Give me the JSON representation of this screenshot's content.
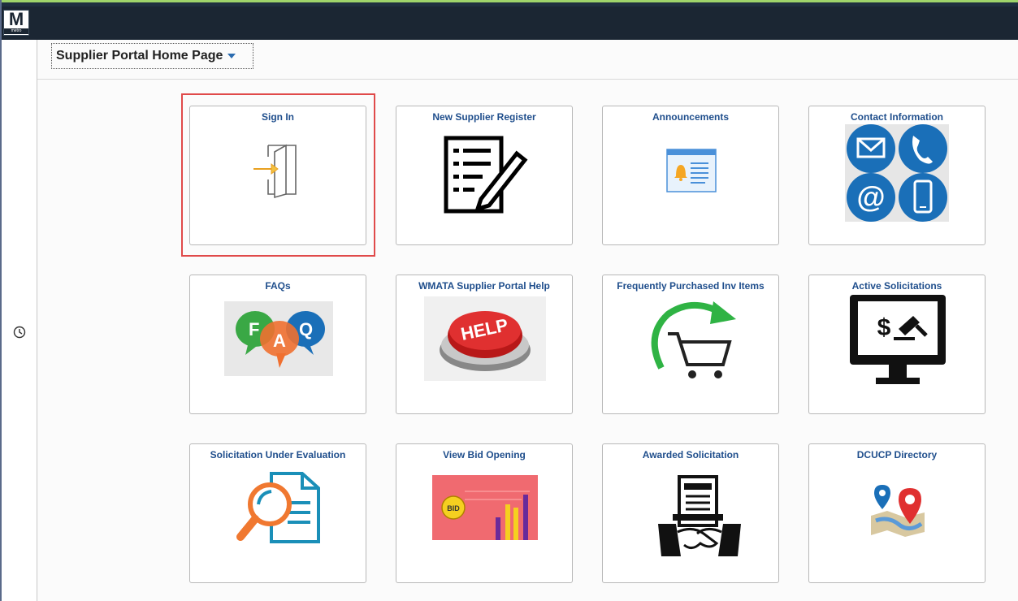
{
  "app": {
    "logo_letter": "M",
    "logo_sub": "metro",
    "page_title": "Supplier Portal Home Page"
  },
  "tiles": [
    {
      "label": "Sign In",
      "icon": "sign-in-door-icon"
    },
    {
      "label": "New Supplier Register",
      "icon": "checklist-pen-icon"
    },
    {
      "label": "Announcements",
      "icon": "announcement-bell-icon"
    },
    {
      "label": "Contact Information",
      "icon": "contact-circles-icon"
    },
    {
      "label": "FAQs",
      "icon": "faq-bubbles-icon"
    },
    {
      "label": "WMATA Supplier Portal Help",
      "icon": "help-button-icon",
      "art_text": "HELP"
    },
    {
      "label": "Frequently Purchased Inv Items",
      "icon": "cart-arrow-icon"
    },
    {
      "label": "Active Solicitations",
      "icon": "monitor-gavel-icon",
      "art_text": "$"
    },
    {
      "label": "Solicitation Under Evaluation",
      "icon": "magnifier-document-icon"
    },
    {
      "label": "View Bid Opening",
      "icon": "bid-chart-icon",
      "art_text": "BID"
    },
    {
      "label": "Awarded Solicitation",
      "icon": "handshake-document-icon"
    },
    {
      "label": "DCUCP Directory",
      "icon": "map-pins-icon"
    }
  ],
  "faq_letters": [
    "F",
    "A",
    "Q"
  ],
  "colors": {
    "header": "#1b2633",
    "tile_label": "#1f4e8c",
    "highlight": "#e04a4a"
  }
}
